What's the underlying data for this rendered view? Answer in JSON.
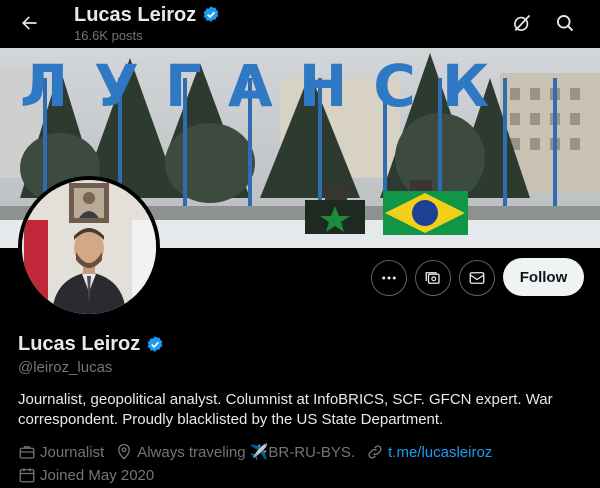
{
  "header": {
    "name": "Lucas Leiroz",
    "posts": "16.6K posts"
  },
  "banner": {
    "sign_text": "ЛУГАНСК"
  },
  "actions": {
    "follow_label": "Follow"
  },
  "profile": {
    "name": "Lucas Leiroz",
    "handle": "@leiroz_lucas",
    "bio": "Journalist, geopolitical analyst. Columnist at InfoBRICS, SCF. GFCN expert. War correspondent. Proudly blacklisted by the US State Department.",
    "profession": "Journalist",
    "location": "Always traveling ✈️BR-RU-BYS.",
    "link": "t.me/lucasleiroz",
    "joined": "Joined May 2020"
  },
  "colors": {
    "accent": "#1d9bf0",
    "background": "#000000",
    "text": "#e7e9ea",
    "muted": "#71767b"
  },
  "icons": [
    "back-arrow-icon",
    "verified-badge-icon",
    "grok-icon",
    "search-icon",
    "more-icon",
    "subscribe-icon",
    "message-icon",
    "briefcase-icon",
    "location-pin-icon",
    "link-icon",
    "calendar-icon"
  ]
}
